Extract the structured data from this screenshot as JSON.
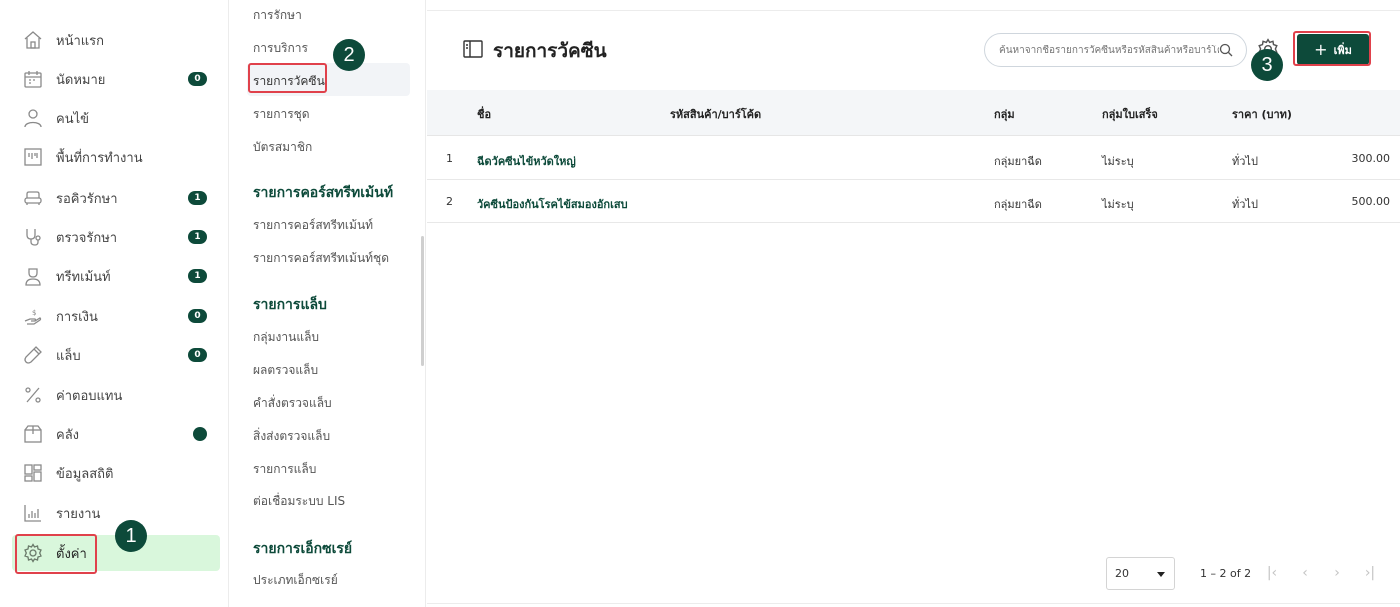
{
  "sidebar": {
    "items": [
      {
        "label": "หน้าแรก",
        "icon": "home-icon",
        "badge": ""
      },
      {
        "label": "นัดหมาย",
        "icon": "calendar-icon",
        "badge": "0"
      },
      {
        "label": "คนไข้",
        "icon": "user-icon",
        "badge": ""
      },
      {
        "label": "พื้นที่การทำงาน",
        "icon": "workspace-icon",
        "badge": ""
      },
      {
        "label": "รอคิวรักษา",
        "icon": "sofa-icon",
        "badge": "1"
      },
      {
        "label": "ตรวจรักษา",
        "icon": "stethoscope-icon",
        "badge": "1"
      },
      {
        "label": "ทรีทเม้นท์",
        "icon": "doctor-icon",
        "badge": "1"
      },
      {
        "label": "การเงิน",
        "icon": "money-hand-icon",
        "badge": "0"
      },
      {
        "label": "แล็บ",
        "icon": "test-tube-icon",
        "badge": "0"
      },
      {
        "label": "ค่าตอบแทน",
        "icon": "percent-icon",
        "badge": ""
      },
      {
        "label": "คลัง",
        "icon": "box-icon",
        "badge": "dot"
      },
      {
        "label": "ข้อมูลสถิติ",
        "icon": "dashboard-icon",
        "badge": ""
      },
      {
        "label": "รายงาน",
        "icon": "bar-chart-icon",
        "badge": ""
      },
      {
        "label": "ตั้งค่า",
        "icon": "gear-icon",
        "badge": ""
      }
    ]
  },
  "submenu": {
    "items_top": [
      "การรักษา",
      "การบริการ",
      "รายการวัคซีน",
      "รายการชุด",
      "บัตรสมาชิก"
    ],
    "treatment_header": "รายการคอร์สทรีทเม้นท์",
    "treatment_items": [
      "รายการคอร์สทรีทเม้นท์",
      "รายการคอร์สทรีทเม้นท์ชุด"
    ],
    "lab_header": "รายการแล็บ",
    "lab_items": [
      "กลุ่มงานแล็บ",
      "ผลตรวจแล็บ",
      "คำสั่งตรวจแล็บ",
      "สิ่งส่งตรวจแล็บ",
      "รายการแล็บ",
      "ต่อเชื่อมระบบ LIS"
    ],
    "xray_header": "รายการเอ็กซเรย์",
    "xray_items": [
      "ประเภทเอ็กซเรย์"
    ]
  },
  "main": {
    "title": "รายการวัคซีน",
    "search_placeholder": "ค้นหาจากชื่อรายการวัคซีนหรือรหัสสินค้าหรือบาร์โค้ด",
    "add_label": "เพิ่ม",
    "columns": [
      "ชื่อ",
      "รหัสสินค้า/บาร์โค้ด",
      "กลุ่ม",
      "กลุ่มใบเสร็จ",
      "ราคา (บาท)"
    ],
    "rows": [
      {
        "index": "1",
        "name": "ฉีดวัคซีนไข้หวัดใหญ่",
        "code": "",
        "group": "กลุ่มยาฉีด",
        "receipt_group": "ไม่ระบุ",
        "price_type": "ทั่วไป",
        "price": "300.00"
      },
      {
        "index": "2",
        "name": "วัคซีนป้องกันโรคไข้สมองอักเสบ",
        "code": "",
        "group": "กลุ่มยาฉีด",
        "receipt_group": "ไม่ระบุ",
        "price_type": "ทั่วไป",
        "price": "500.00"
      }
    ],
    "page_size": "20",
    "page_info": "1 – 2 of 2"
  },
  "annotations": {
    "step1": "1",
    "step2": "2",
    "step3": "3",
    "highlight_color": "#e0414b"
  },
  "colors": {
    "accent": "#0d4a3a",
    "active_bg": "#d9f7dc"
  }
}
